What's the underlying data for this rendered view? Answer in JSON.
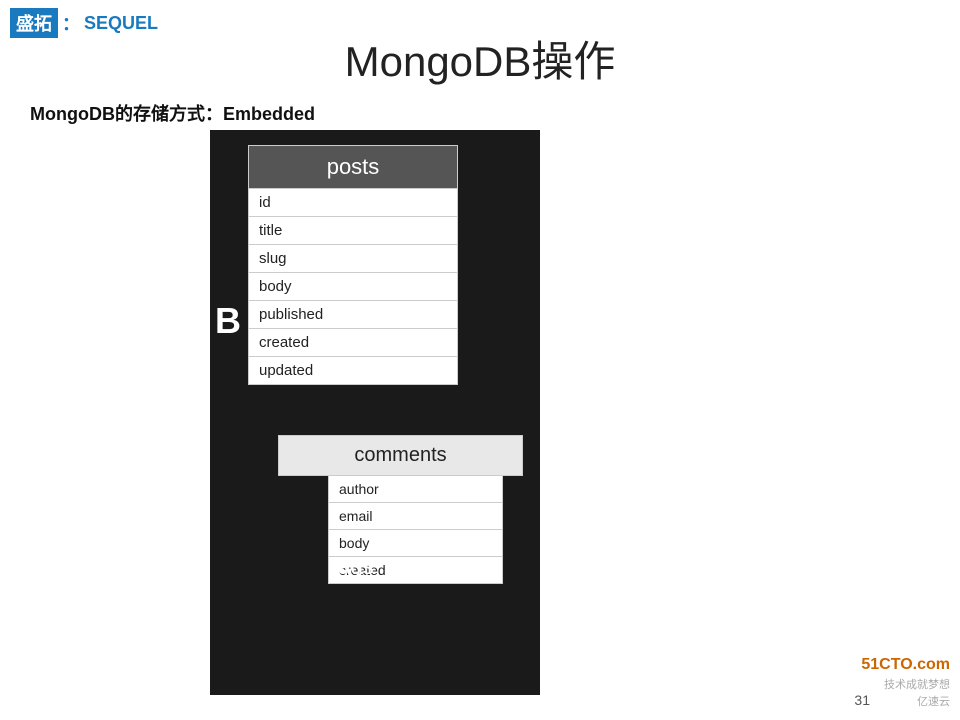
{
  "logo": {
    "brand": "盛拓",
    "colon": "：",
    "sequel": "SEQUEL"
  },
  "page": {
    "title": "MongoDB操作",
    "subtitle": "MongoDB的存储方式：Embedded"
  },
  "posts_table": {
    "header": "posts",
    "rows": [
      "id",
      "title",
      "slug",
      "body",
      "published",
      "created",
      "updated"
    ]
  },
  "comments_box": {
    "header": "comments"
  },
  "comments_inner": {
    "rows": [
      "author",
      "email",
      "body",
      "created"
    ]
  },
  "tags": {
    "label": "tags"
  },
  "page_number": "31",
  "watermark": {
    "site": "51CTO.com",
    "line1": "技术成就梦想",
    "line2": "亿速云"
  }
}
